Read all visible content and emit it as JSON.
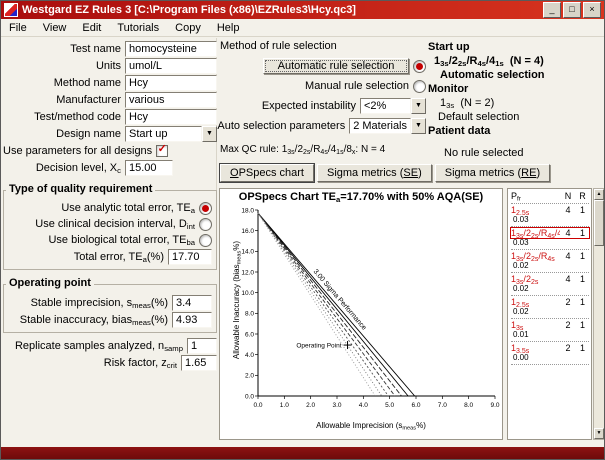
{
  "window": {
    "title": "Westgard EZ Rules 3  [C:\\Program Files (x86)\\EZRules3\\Hcy.qc3]",
    "controls": {
      "minimize": "_",
      "maximize": "□",
      "close": "×"
    }
  },
  "icons": {
    "check": "✓",
    "combo_arrow": "▼",
    "scroll_up": "▲",
    "scroll_down": "▼"
  },
  "menu": [
    "File",
    "View",
    "Edit",
    "Tutorials",
    "Copy",
    "Help"
  ],
  "left": {
    "fields": [
      {
        "label": [
          [
            "t",
            "Test name"
          ]
        ],
        "value": "homocysteine"
      },
      {
        "label": [
          [
            "t",
            "Units"
          ]
        ],
        "value": "umol/L"
      },
      {
        "label": [
          [
            "t",
            "Method name"
          ]
        ],
        "value": "Hcy"
      },
      {
        "label": [
          [
            "t",
            "Manufacturer"
          ]
        ],
        "value": "various"
      },
      {
        "label": [
          [
            "t",
            "Test/method code"
          ]
        ],
        "value": "Hcy"
      }
    ],
    "design_name": {
      "label": [
        [
          "t",
          "Design name"
        ]
      ],
      "value": "Start up"
    },
    "use_params": {
      "label": [
        [
          "t",
          "Use parameters for all designs"
        ]
      ]
    },
    "decision_level": {
      "label": [
        [
          "t",
          "Decision level, X"
        ],
        [
          "s",
          "c"
        ]
      ],
      "value": "15.00"
    },
    "quality": {
      "title": "Type of quality requirement",
      "options": [
        {
          "label": [
            [
              "t",
              "Use analytic total error, TE"
            ],
            [
              "s",
              "a"
            ]
          ],
          "selected": true
        },
        {
          "label": [
            [
              "t",
              "Use clinical decision interval, D"
            ],
            [
              "s",
              "int"
            ]
          ],
          "selected": false
        },
        {
          "label": [
            [
              "t",
              "Use biological total error, TE"
            ],
            [
              "s",
              "ba"
            ]
          ],
          "selected": false
        }
      ],
      "total_error": {
        "label": [
          [
            "t",
            "Total error, TE"
          ],
          [
            "s",
            "a"
          ],
          [
            "t",
            "(%)"
          ]
        ],
        "value": "17.70"
      }
    },
    "operating_point": {
      "title": "Operating point",
      "fields": [
        {
          "label": [
            [
              "t",
              "Stable imprecision, s"
            ],
            [
              "s",
              "meas"
            ],
            [
              "t",
              "(%)"
            ]
          ],
          "value": "3.4"
        },
        {
          "label": [
            [
              "t",
              "Stable inaccuracy, bias"
            ],
            [
              "s",
              "meas"
            ],
            [
              "t",
              "(%)"
            ]
          ],
          "value": "4.93"
        }
      ]
    },
    "replicate": {
      "label": [
        [
          "t",
          "Replicate samples analyzed, n"
        ],
        [
          "s",
          "samp"
        ]
      ],
      "value": "1"
    },
    "risk": {
      "label": [
        [
          "t",
          "Risk factor, z"
        ],
        [
          "s",
          "crit"
        ]
      ],
      "value": "1.65"
    }
  },
  "middle": {
    "method_title": "Method of rule selection",
    "auto_btn": "Automatic rule selection",
    "manual_label": "Manual rule selection",
    "expected_instability": {
      "label": "Expected instability",
      "value": "<2%"
    },
    "auto_params": {
      "label": "Auto selection parameters",
      "value": "2 Materials"
    },
    "max_qc": {
      "prefix": "Max QC rule: ",
      "rule": "1_3s/2_2s/R_4s/4_1s/8_x",
      "suffix": ": N = 4"
    }
  },
  "status": {
    "design": "Start up",
    "rule": "1_3s/2_2s/R_4s/4_1s",
    "rule_n": "(N = 4)",
    "selection": "Automatic selection",
    "monitor": "Monitor",
    "monitor_rule": "1_3s",
    "monitor_n": "(N = 2)",
    "monitor_selection": "Default selection",
    "patient": "Patient data",
    "patient_rule": "No rule selected"
  },
  "tabs": [
    {
      "label": [
        [
          "u",
          "O"
        ],
        [
          "t",
          "PSpecs chart"
        ]
      ],
      "active": true
    },
    {
      "label": [
        [
          "t",
          "Sigma metrics ("
        ],
        [
          "u",
          "SE"
        ],
        [
          "t",
          ")"
        ]
      ],
      "active": false
    },
    {
      "label": [
        [
          "t",
          "Sigma metrics ("
        ],
        [
          "u",
          "RE"
        ],
        [
          "t",
          ")"
        ]
      ],
      "active": false
    }
  ],
  "chart_data": {
    "type": "line",
    "title": [
      [
        "t",
        "OPSpecs Chart TE"
      ],
      [
        "s",
        "a"
      ],
      [
        "t",
        "=17.70% with 50% AQA(SE)"
      ]
    ],
    "xlabel": [
      [
        "t",
        "Allowable Imprecision (s"
      ],
      [
        "s",
        "meas"
      ],
      [
        "t",
        "%)"
      ]
    ],
    "ylabel": [
      [
        "t",
        "Allowable Inaccuracy (bias"
      ],
      [
        "s",
        "meas"
      ],
      [
        "t",
        "%)"
      ]
    ],
    "xlim": [
      0,
      9
    ],
    "ylim": [
      0,
      18
    ],
    "xtick_step": 1,
    "ytick_step": 2,
    "grid": false,
    "tea": 17.7,
    "lines": [
      {
        "x_intercept": 5.95,
        "dash": "",
        "color": "#000000"
      },
      {
        "x_intercept": 5.7,
        "dash": "",
        "color": "#000000"
      },
      {
        "x_intercept": 5.45,
        "dash": "5,2",
        "color": "#222222"
      },
      {
        "x_intercept": 5.2,
        "dash": "4,2",
        "color": "#333333"
      },
      {
        "x_intercept": 4.95,
        "dash": "2,2",
        "color": "#555555"
      },
      {
        "x_intercept": 4.7,
        "dash": "1,2",
        "color": "#777777"
      },
      {
        "x_intercept": 4.45,
        "dash": "1,2",
        "color": "#999999"
      }
    ],
    "sigma_label": "3.00 Sigma Performance",
    "operating_point": {
      "x": 3.4,
      "y": 4.93,
      "label": "Operating Point"
    }
  },
  "rules_panel": {
    "header": {
      "pfr": "P",
      "pfr_sub": "fr",
      "n": "N",
      "r": "R"
    },
    "rows": [
      {
        "rule": "1_2.5s",
        "pfr": "0.03",
        "n": "4",
        "r": "1",
        "selected": false
      },
      {
        "rule": "1_3s/2_2s/R_4s/4_1s",
        "pfr": "0.03",
        "n": "4",
        "r": "1",
        "selected": true
      },
      {
        "rule": "1_3s/2_2s/R_4s",
        "pfr": "0.02",
        "n": "4",
        "r": "1",
        "selected": false
      },
      {
        "rule": "1_3s/2_2s",
        "pfr": "0.02",
        "n": "4",
        "r": "1",
        "selected": false
      },
      {
        "rule": "1_2.5s",
        "pfr": "0.02",
        "n": "2",
        "r": "1",
        "selected": false
      },
      {
        "rule": "1_3s",
        "pfr": "0.01",
        "n": "2",
        "r": "1",
        "selected": false
      },
      {
        "rule": "1_3.5s",
        "pfr": "0.00",
        "n": "2",
        "r": "1",
        "selected": false
      }
    ]
  }
}
